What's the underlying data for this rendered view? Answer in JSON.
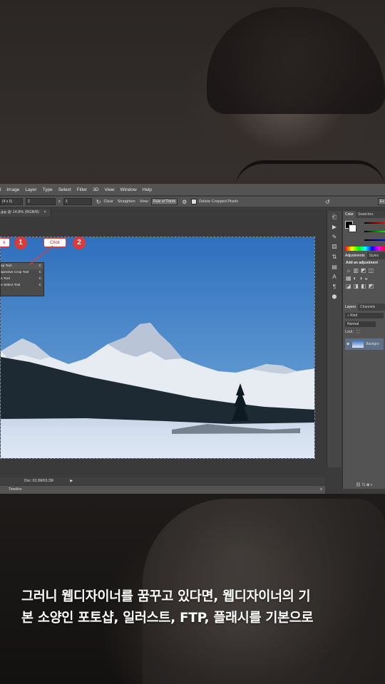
{
  "menu": [
    "it",
    "Image",
    "Layer",
    "Type",
    "Select",
    "Filter",
    "3D",
    "View",
    "Window",
    "Help"
  ],
  "options": {
    "ratio": "(4 x 5)",
    "w": "2",
    "x_label": "x",
    "h": "3",
    "clear_label": "Clear",
    "straighten_label": "Straighten",
    "view_label": "View:",
    "view_value": "Rule of Thirds",
    "delete_cropped_label": "Delete Cropped Pixels",
    "right_btn": "Ex"
  },
  "doc_tab": ".jpg @ 14.8% (RGB/8)",
  "context_menu": [
    {
      "label": "op Tool",
      "key": "C"
    },
    {
      "label": "spective Crop Tool",
      "key": "C"
    },
    {
      "label": "e Tool",
      "key": "C"
    },
    {
      "label": "e Select Tool",
      "key": "C"
    }
  ],
  "callouts": {
    "left_text": "k",
    "right_text": "Click",
    "badge1": "1",
    "badge2": "2"
  },
  "status": {
    "doc": "Doc: 63.3M/63.3M",
    "timeline": "Timeline"
  },
  "panels": {
    "color_tabs": [
      "Color",
      "Swatches"
    ],
    "adjust_tabs": [
      "Adjustments",
      "Styles"
    ],
    "adjust_add": "Add an adjustment",
    "layers_tabs": [
      "Layers",
      "Channels"
    ],
    "kind": "Kind",
    "blend": "Normal",
    "lock": "Lock:",
    "layer_name": "Backgro"
  },
  "caption": {
    "line1": "그러니 웹디자이너를 꿈꾸고 있다면, 웹디자이너의 기",
    "line2": "본 소양인 포토샵, 일러스트, FTP, 플래시를 기본으로"
  }
}
